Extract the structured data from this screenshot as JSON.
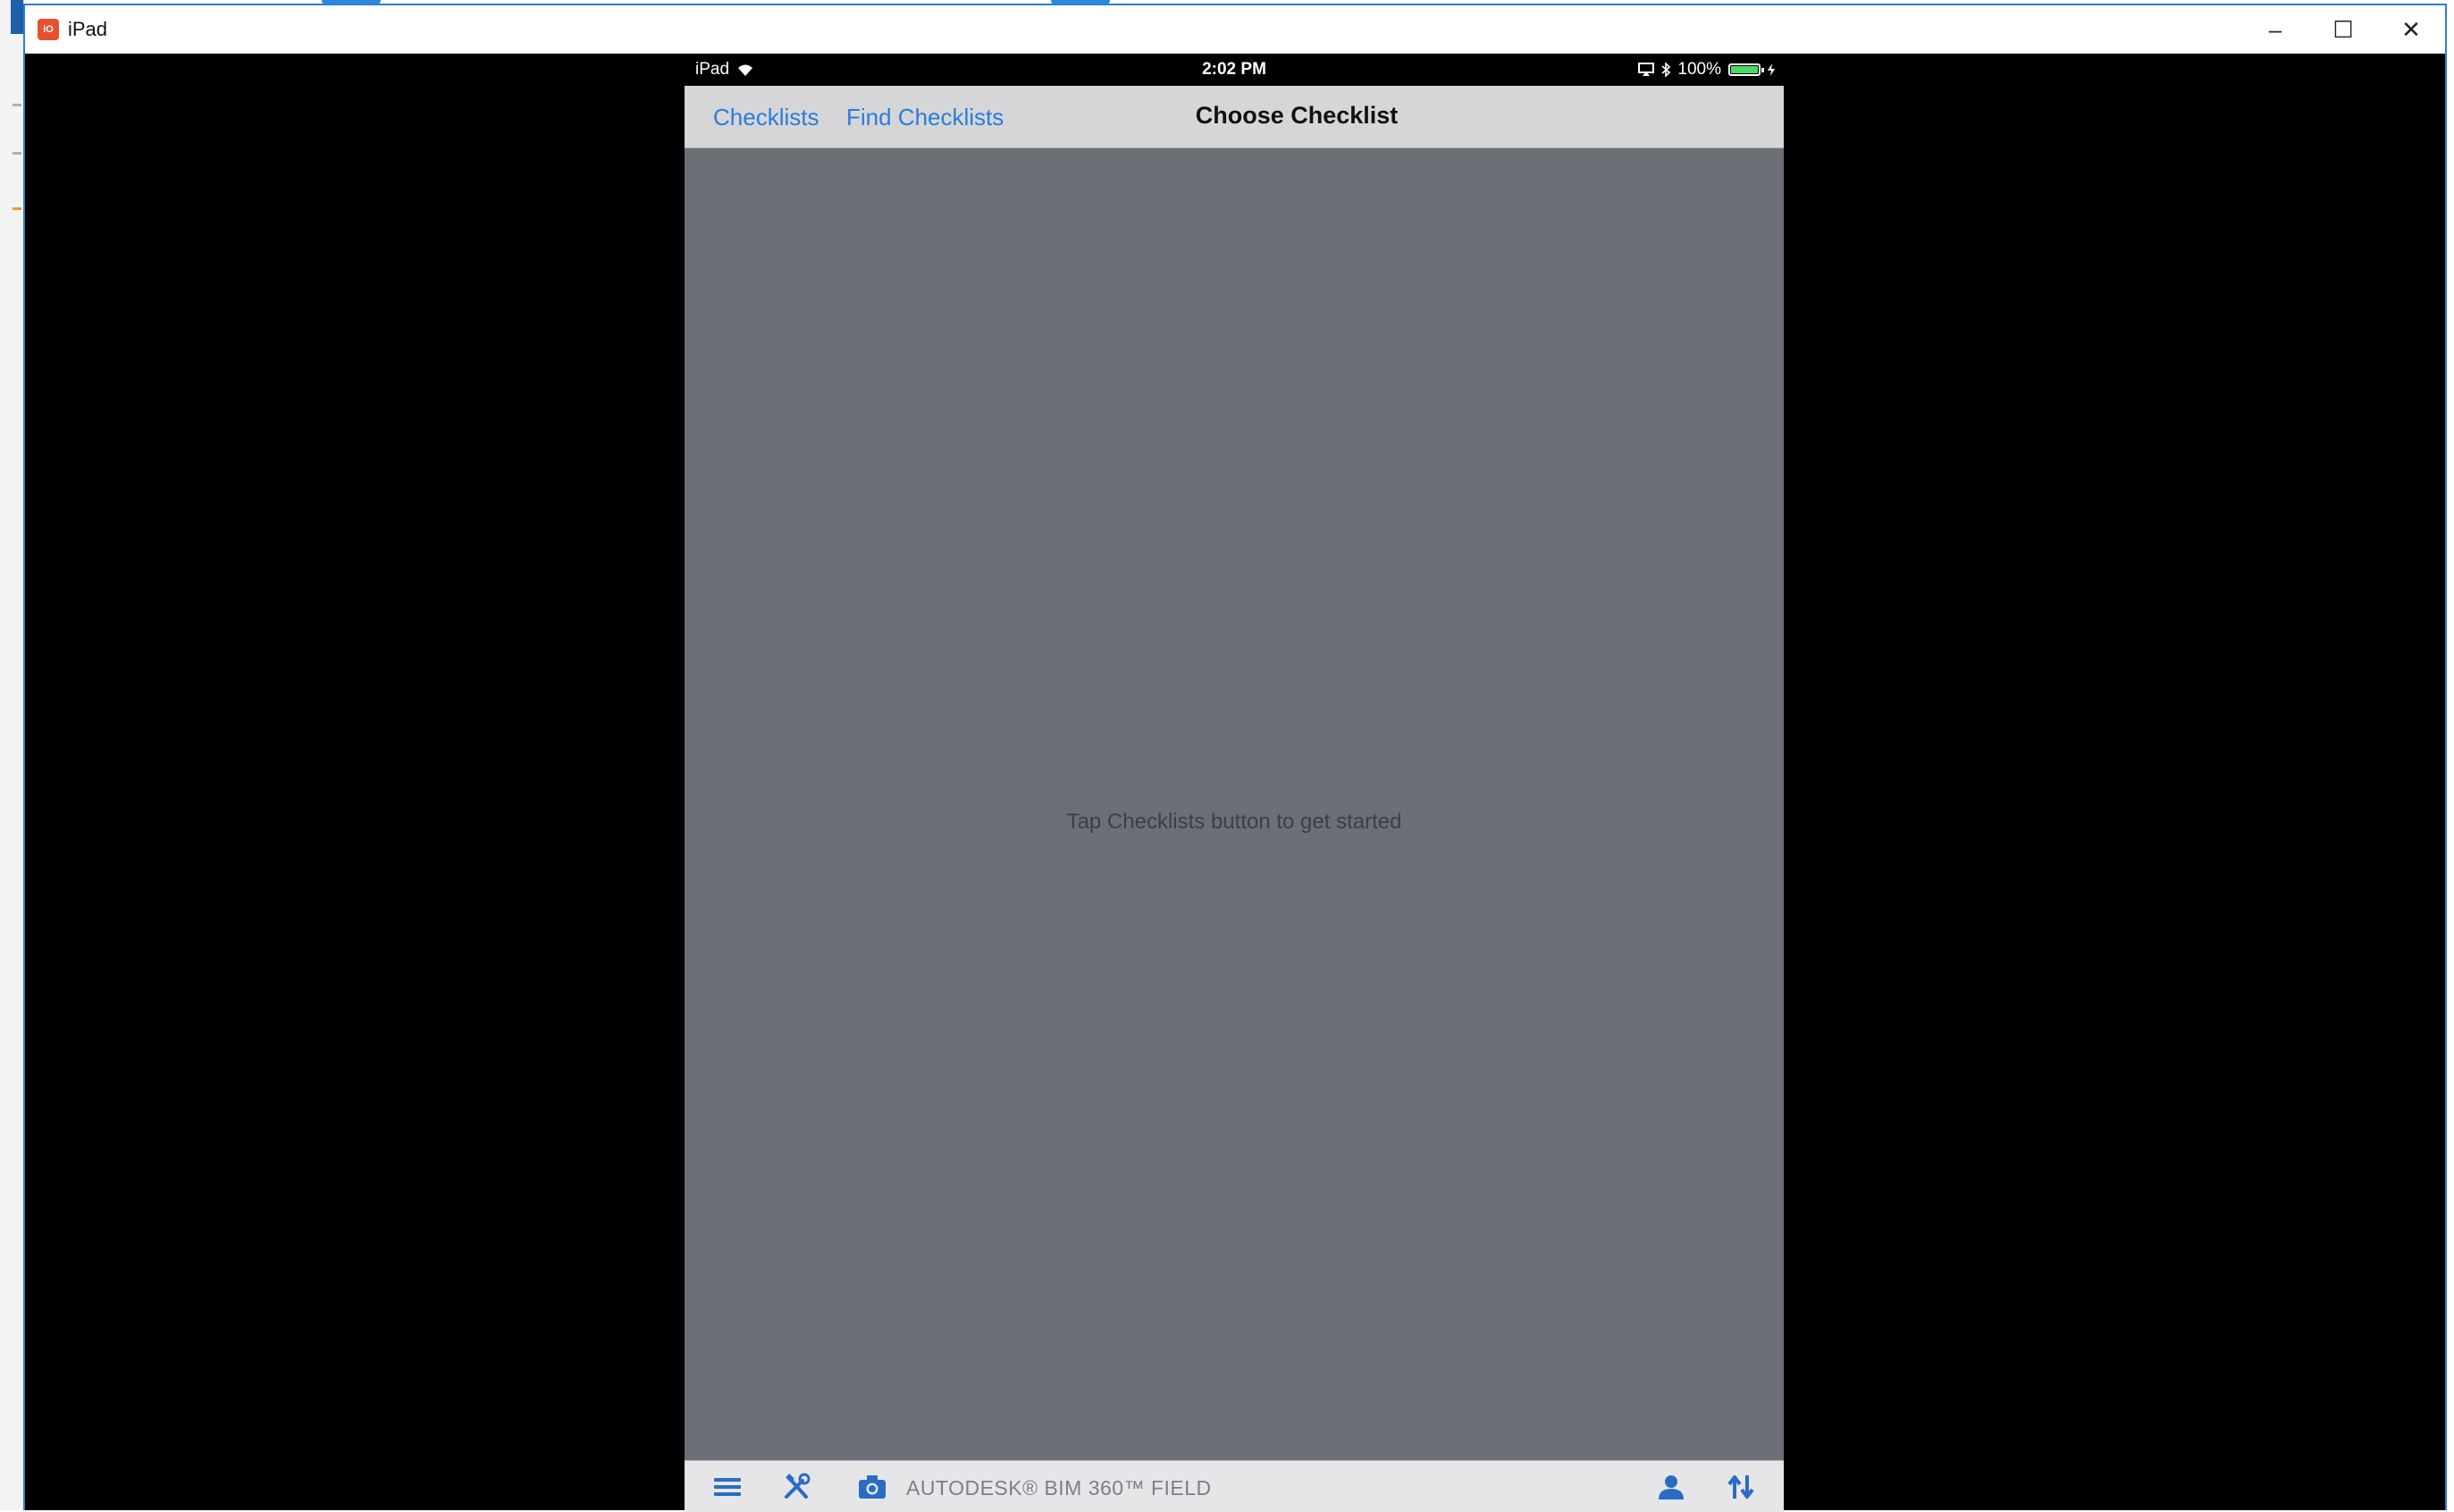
{
  "window": {
    "title": "iPad",
    "icon_label": "iO",
    "minimize_glyph": "–",
    "maximize_glyph": "☐",
    "close_glyph": "✕"
  },
  "statusbar": {
    "device": "iPad",
    "time": "2:02 PM",
    "battery": "100%",
    "battery_level": 1.0
  },
  "navbar": {
    "links": [
      "Checklists",
      "Find Checklists"
    ],
    "title": "Choose Checklist"
  },
  "content": {
    "hint": "Tap Checklists button to get started",
    "background_color": "#6d6f77"
  },
  "tabbar": {
    "brand": "AUTODESK® BIM 360™ FIELD",
    "icons": [
      "menu-icon",
      "tools-icon",
      "camera-icon",
      "user-icon",
      "sync-icon"
    ],
    "icon_color": "#2a6cc4"
  },
  "colors": {
    "link": "#2a7dd9",
    "window_border": "#2b7fd2"
  }
}
